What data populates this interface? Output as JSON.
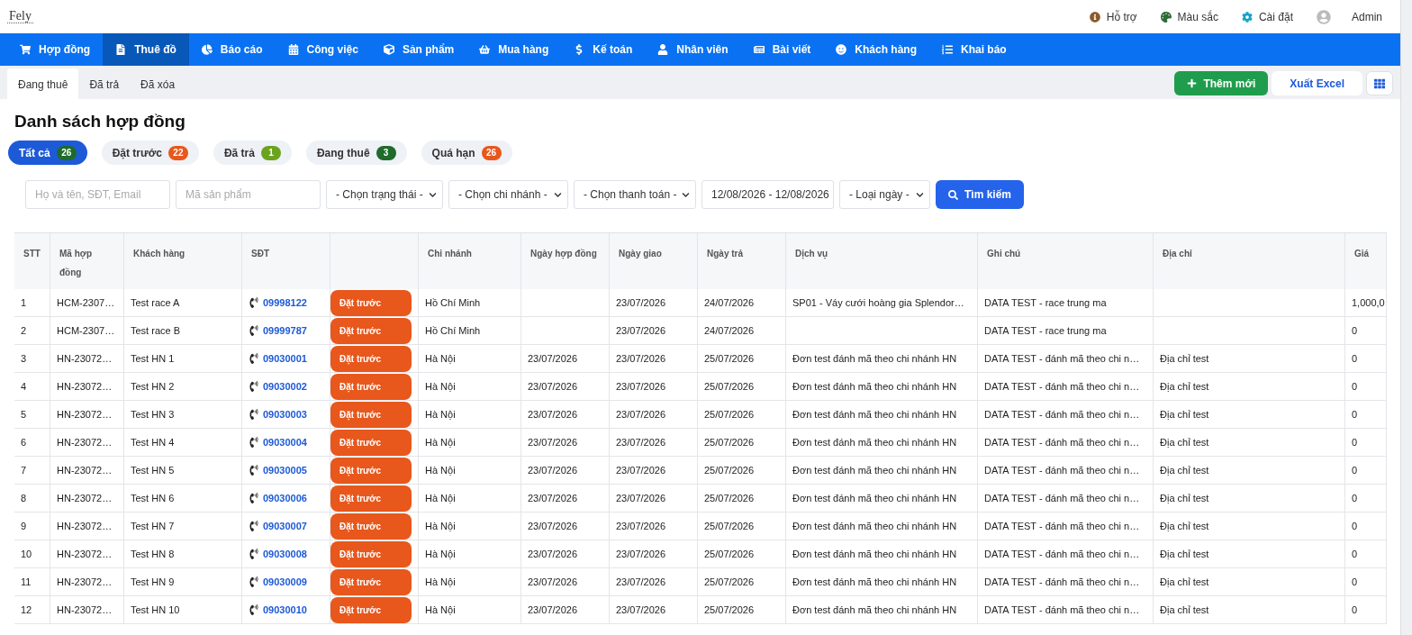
{
  "header": {
    "logo": "Fely",
    "links": [
      {
        "kind": "info",
        "label": "Hỗ trợ"
      },
      {
        "kind": "palette",
        "label": "Màu sắc"
      },
      {
        "kind": "gear",
        "label": "Cài đặt"
      }
    ],
    "user": "Admin"
  },
  "nav": [
    {
      "kind": "cart",
      "label": "Hợp đồng",
      "selected": false
    },
    {
      "kind": "doc",
      "label": "Thuê đồ",
      "selected": true
    },
    {
      "kind": "pie",
      "label": "Báo cáo",
      "selected": false
    },
    {
      "kind": "calendar",
      "label": "Công việc",
      "selected": false
    },
    {
      "kind": "box",
      "label": "Sản phẩm",
      "selected": false
    },
    {
      "kind": "basket",
      "label": "Mua hàng",
      "selected": false
    },
    {
      "kind": "dollar",
      "label": "Kế toán",
      "selected": false
    },
    {
      "kind": "user",
      "label": "Nhân viên",
      "selected": false
    },
    {
      "kind": "news",
      "label": "Bài viết",
      "selected": false
    },
    {
      "kind": "smile",
      "label": "Khách hàng",
      "selected": false
    },
    {
      "kind": "list",
      "label": "Khai báo",
      "selected": false
    }
  ],
  "tabs": [
    {
      "label": "Đang thuê",
      "selected": true
    },
    {
      "label": "Đã trả",
      "selected": false
    },
    {
      "label": "Đã xóa",
      "selected": false
    }
  ],
  "actions": {
    "add": "Thêm mới",
    "export": "Xuất Excel"
  },
  "title": "Danh sách hợp đồng",
  "chips": [
    {
      "label": "Tất cả",
      "count": "26",
      "color": "#1e6b2a",
      "selected": true
    },
    {
      "label": "Đặt trước",
      "count": "22",
      "color": "#e8571c",
      "selected": false
    },
    {
      "label": "Đã trả",
      "count": "1",
      "color": "#6ba31f",
      "selected": false
    },
    {
      "label": "Đang thuê",
      "count": "3",
      "color": "#1e6b2a",
      "selected": false
    },
    {
      "label": "Quá hạn",
      "count": "26",
      "color": "#e8571c",
      "selected": false
    }
  ],
  "filters": {
    "search": {
      "placeholder": "Họ và tên, SĐT, Email"
    },
    "product": {
      "placeholder": "Mã sản phẩm"
    },
    "selects": [
      "- Chọn trạng thái -",
      "- Chọn chi nhánh -",
      "- Chọn thanh toán -"
    ],
    "date_range": "12/08/2026 - 12/08/2026",
    "date_type": "- Loại ngày -",
    "search_button": "Tìm kiếm"
  },
  "table": {
    "columns": [
      "STT",
      "Mã hợp đồng",
      "Khách hàng",
      "SĐT",
      "",
      "Chi nhánh",
      "Ngày hợp đồng",
      "Ngày giao",
      "Ngày trả",
      "Dịch vụ",
      "Ghi chú",
      "Địa chỉ",
      "Giá"
    ],
    "rows": [
      [
        "1",
        "HCM-2307…",
        "Test race A",
        "09998122",
        "Đặt trước",
        "Hồ Chí Minh",
        "",
        "23/07/2026",
        "24/07/2026",
        "SP01 - Váy cưới hoàng gia Splendor…",
        "DATA TEST - race trung ma",
        "",
        "1,000,0"
      ],
      [
        "2",
        "HCM-2307…",
        "Test race B",
        "09999787",
        "Đặt trước",
        "Hồ Chí Minh",
        "",
        "23/07/2026",
        "24/07/2026",
        "",
        "DATA TEST - race trung ma",
        "",
        "0"
      ],
      [
        "3",
        "HN-23072…",
        "Test HN 1",
        "09030001",
        "Đặt trước",
        "Hà Nội",
        "23/07/2026",
        "23/07/2026",
        "25/07/2026",
        "Đơn test đánh mã theo chi nhánh HN",
        "DATA TEST - đánh mã theo chi n…",
        "Địa chỉ test",
        "0"
      ],
      [
        "4",
        "HN-23072…",
        "Test HN 2",
        "09030002",
        "Đặt trước",
        "Hà Nội",
        "23/07/2026",
        "23/07/2026",
        "25/07/2026",
        "Đơn test đánh mã theo chi nhánh HN",
        "DATA TEST - đánh mã theo chi n…",
        "Địa chỉ test",
        "0"
      ],
      [
        "5",
        "HN-23072…",
        "Test HN 3",
        "09030003",
        "Đặt trước",
        "Hà Nội",
        "23/07/2026",
        "23/07/2026",
        "25/07/2026",
        "Đơn test đánh mã theo chi nhánh HN",
        "DATA TEST - đánh mã theo chi n…",
        "Địa chỉ test",
        "0"
      ],
      [
        "6",
        "HN-23072…",
        "Test HN 4",
        "09030004",
        "Đặt trước",
        "Hà Nội",
        "23/07/2026",
        "23/07/2026",
        "25/07/2026",
        "Đơn test đánh mã theo chi nhánh HN",
        "DATA TEST - đánh mã theo chi n…",
        "Địa chỉ test",
        "0"
      ],
      [
        "7",
        "HN-23072…",
        "Test HN 5",
        "09030005",
        "Đặt trước",
        "Hà Nội",
        "23/07/2026",
        "23/07/2026",
        "25/07/2026",
        "Đơn test đánh mã theo chi nhánh HN",
        "DATA TEST - đánh mã theo chi n…",
        "Địa chỉ test",
        "0"
      ],
      [
        "8",
        "HN-23072…",
        "Test HN 6",
        "09030006",
        "Đặt trước",
        "Hà Nội",
        "23/07/2026",
        "23/07/2026",
        "25/07/2026",
        "Đơn test đánh mã theo chi nhánh HN",
        "DATA TEST - đánh mã theo chi n…",
        "Địa chỉ test",
        "0"
      ],
      [
        "9",
        "HN-23072…",
        "Test HN 7",
        "09030007",
        "Đặt trước",
        "Hà Nội",
        "23/07/2026",
        "23/07/2026",
        "25/07/2026",
        "Đơn test đánh mã theo chi nhánh HN",
        "DATA TEST - đánh mã theo chi n…",
        "Địa chỉ test",
        "0"
      ],
      [
        "10",
        "HN-23072…",
        "Test HN 8",
        "09030008",
        "Đặt trước",
        "Hà Nội",
        "23/07/2026",
        "23/07/2026",
        "25/07/2026",
        "Đơn test đánh mã theo chi nhánh HN",
        "DATA TEST - đánh mã theo chi n…",
        "Địa chỉ test",
        "0"
      ],
      [
        "11",
        "HN-23072…",
        "Test HN 9",
        "09030009",
        "Đặt trước",
        "Hà Nội",
        "23/07/2026",
        "23/07/2026",
        "25/07/2026",
        "Đơn test đánh mã theo chi nhánh HN",
        "DATA TEST - đánh mã theo chi n…",
        "Địa chỉ test",
        "0"
      ],
      [
        "12",
        "HN-23072…",
        "Test HN 10",
        "09030010",
        "Đặt trước",
        "Hà Nội",
        "23/07/2026",
        "23/07/2026",
        "25/07/2026",
        "Đơn test đánh mã theo chi nhánh HN",
        "DATA TEST - đánh mã theo chi n…",
        "Địa chỉ test",
        "0"
      ]
    ]
  }
}
